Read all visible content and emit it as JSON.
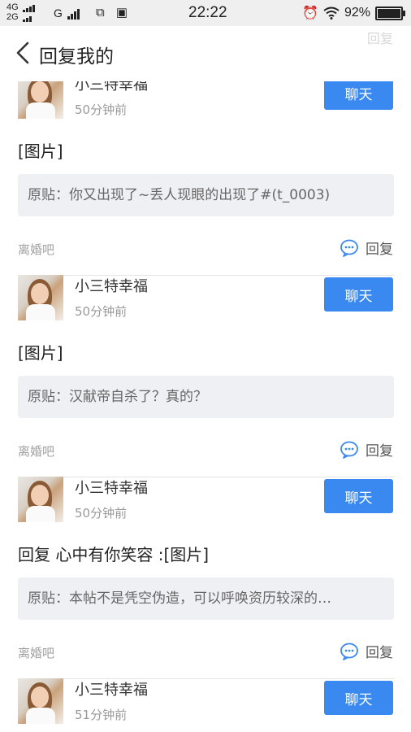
{
  "status_bar": {
    "network_1": "4G",
    "network_2": "2G",
    "network_3": "G",
    "time": "22:22",
    "battery": "92%",
    "battery_level": 0.92
  },
  "header": {
    "title": "回复我的",
    "ghost_reply": "回复"
  },
  "colors": {
    "accent": "#3a89f0"
  },
  "posts": [
    {
      "username": "小三特幸福",
      "time": "50分钟前",
      "chat_label": "聊天",
      "content": "[图片]",
      "quote": "原贴：你又出现了~丢人现眼的出现了#(t_0003)",
      "forum": "离婚吧",
      "reply_label": "回复"
    },
    {
      "username": "小三特幸福",
      "time": "50分钟前",
      "chat_label": "聊天",
      "content": "[图片]",
      "quote": "原贴：汉献帝自杀了？真的？",
      "forum": "离婚吧",
      "reply_label": "回复"
    },
    {
      "username": "小三特幸福",
      "time": "50分钟前",
      "chat_label": "聊天",
      "content": "回复 心中有你笑容 :[图片]",
      "quote": "原贴：本帖不是凭空伪造，可以呼唤资历较深的…",
      "forum": "离婚吧",
      "reply_label": "回复"
    },
    {
      "username": "小三特幸福",
      "time": "51分钟前",
      "chat_label": "聊天"
    }
  ]
}
